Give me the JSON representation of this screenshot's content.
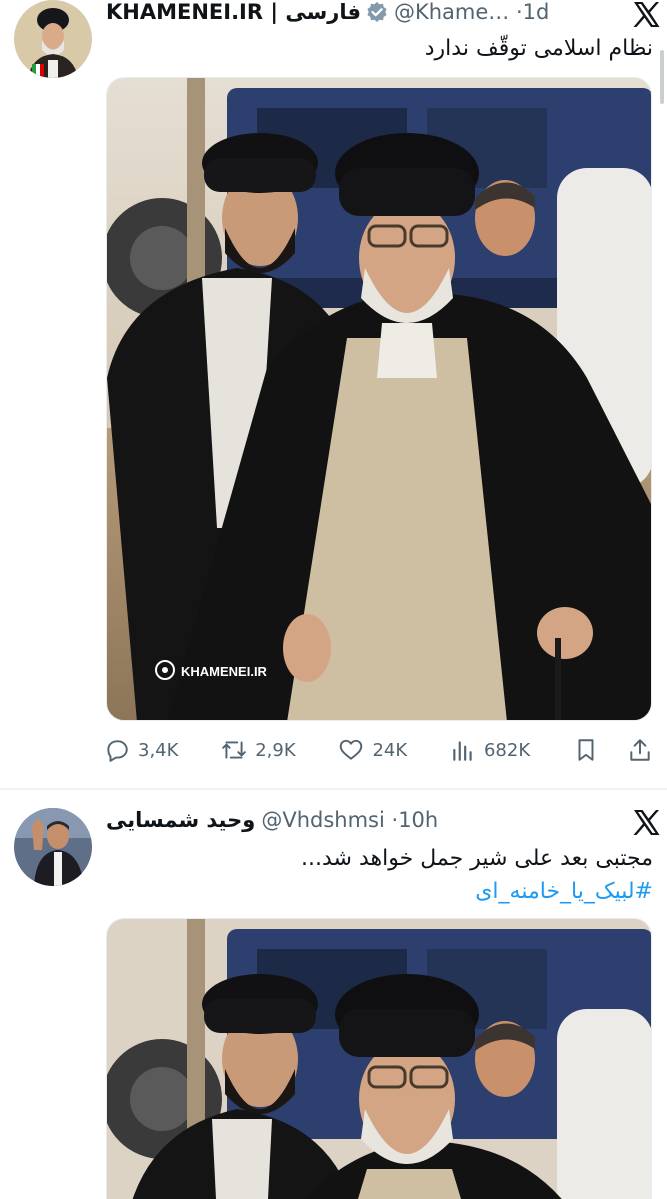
{
  "tweets": [
    {
      "display_name": "KHAMENEI.IR | فارسی",
      "handle": "@Khame…",
      "time": "1d",
      "text": "نظام اسلامی توقّف ندارد",
      "hashtag": "",
      "verified": true,
      "media_watermark": "KHAMENEI.IR",
      "stats": {
        "replies": "3,4K",
        "retweets": "2,9K",
        "likes": "24K",
        "views": "682K"
      }
    },
    {
      "display_name": "وحید شمسایی",
      "handle": "@Vhdshmsi",
      "time": "10h",
      "text": "مجتبی بعد علی شیر جمل خواهد شد...",
      "hashtag": "#لبیک_یا_خامنه_ای",
      "verified": false
    }
  ],
  "colors": {
    "link": "#1d9bf0",
    "secondary_text": "#536471",
    "verified_badge": "#829aab"
  },
  "icons": [
    "x-logo-icon",
    "verified-badge-icon",
    "reply-icon",
    "retweet-icon",
    "like-icon",
    "views-icon",
    "bookmark-icon",
    "share-icon"
  ]
}
